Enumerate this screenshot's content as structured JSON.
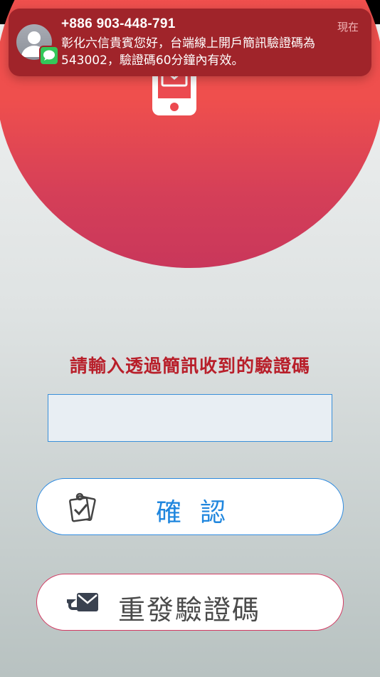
{
  "notification": {
    "sender": "+886 903-448-791",
    "time": "現在",
    "message": "彰化六信貴賓您好，台端線上開戶簡訊驗證碼為543002，驗證碼60分鐘內有效。",
    "avatar_icon": "person-avatar-icon",
    "app_icon": "messages-app-icon",
    "colors": {
      "background": "#a0242a",
      "badge": "#34c759"
    }
  },
  "hero": {
    "icon": "phone-message-icon",
    "colors": {
      "top": "#f0504e",
      "bottom": "#c9375b"
    }
  },
  "prompt": "請輸入透過簡訊收到的驗證碼",
  "code_input": {
    "value": "",
    "placeholder": ""
  },
  "buttons": {
    "confirm": {
      "label": "確認",
      "icon": "clipboard-check-icon",
      "color": "#1f86de"
    },
    "resend": {
      "label": "重發驗證碼",
      "icon": "resend-envelope-icon",
      "color": "#d23a62"
    }
  }
}
